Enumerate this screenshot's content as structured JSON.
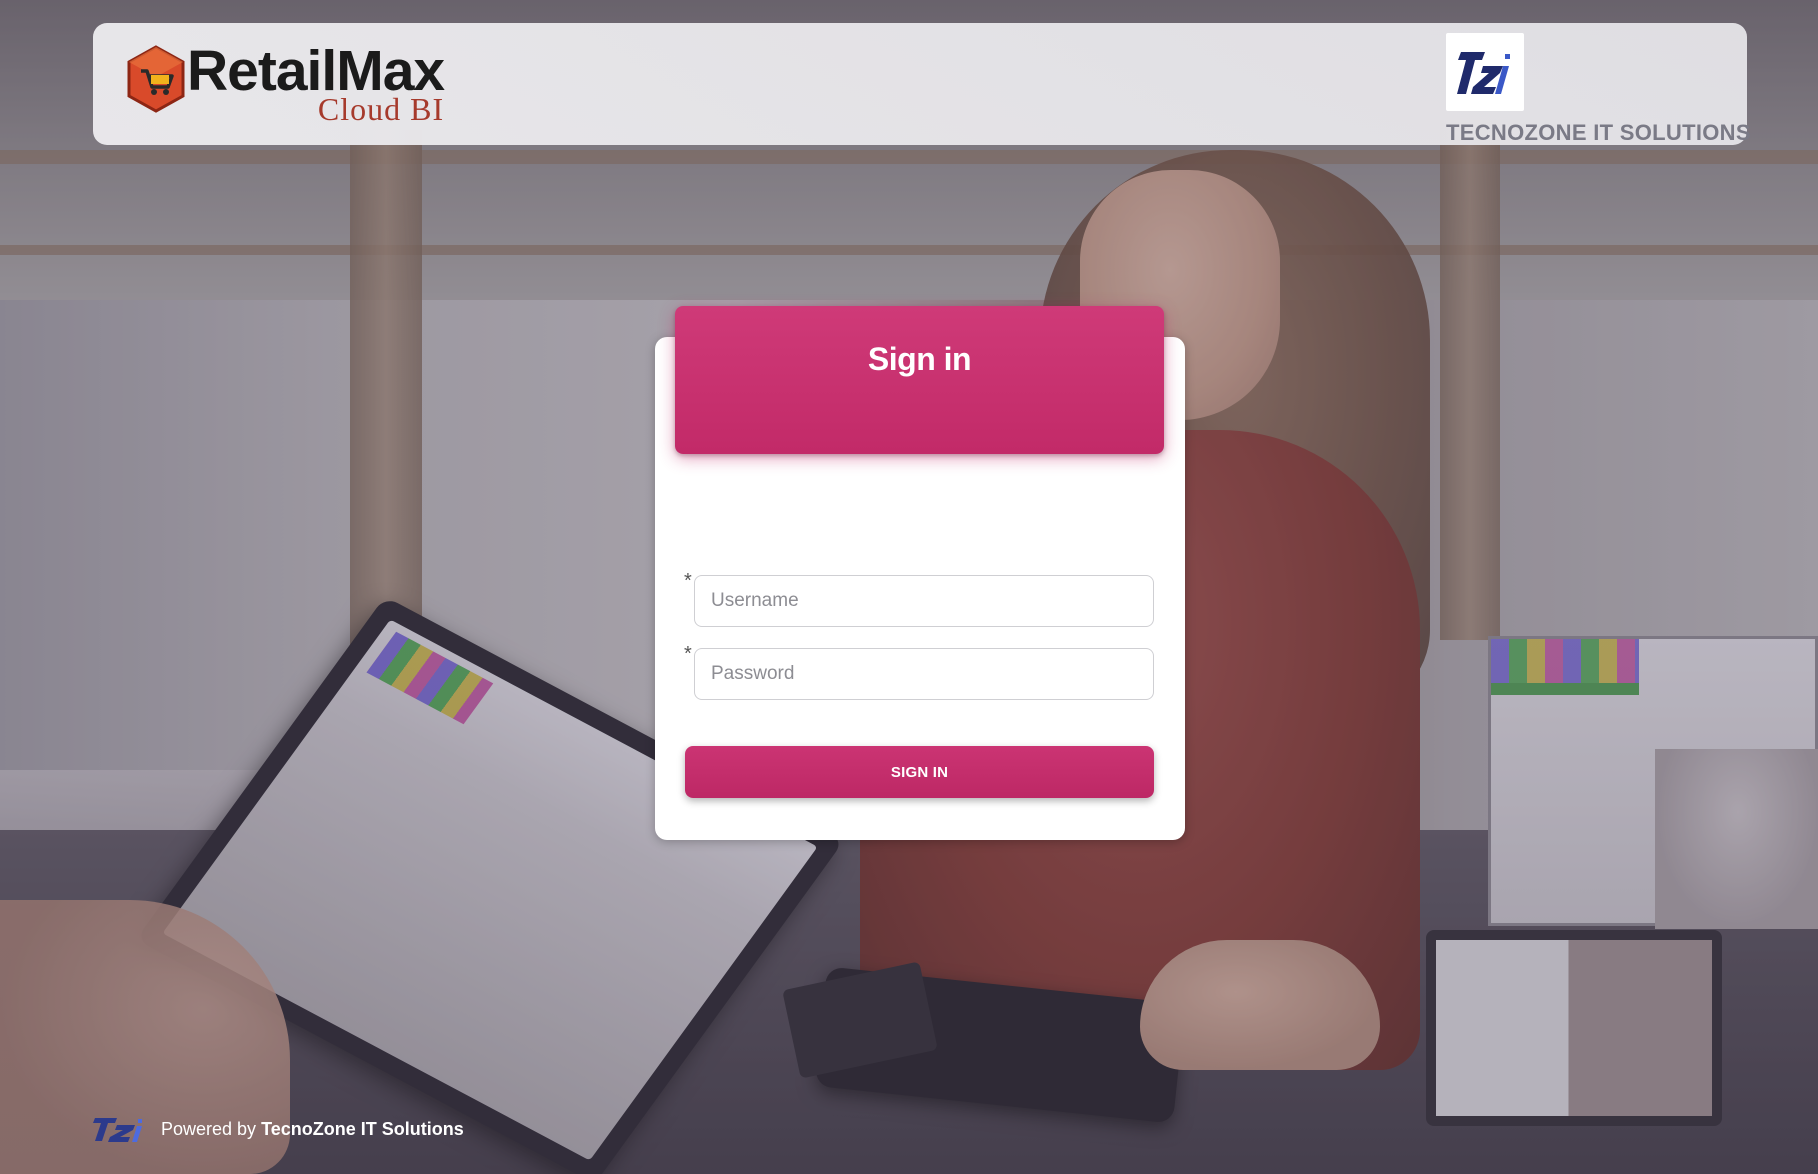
{
  "header": {
    "brand": {
      "main": "RetailMax",
      "sub": "Cloud BI",
      "logo_icon": "shopping-cart-hexagon-icon"
    },
    "partner": {
      "logo_text": "TZi",
      "name": "TECNOZONE IT SOLUTIONS",
      "logo_icon": "tz-logo-icon"
    }
  },
  "signin": {
    "title": "Sign in",
    "username": {
      "placeholder": "Username",
      "value": "",
      "required_mark": "*"
    },
    "password": {
      "placeholder": "Password",
      "value": "",
      "required_mark": "*"
    },
    "button_label": "SIGN IN"
  },
  "footer": {
    "logo_icon": "tz-logo-icon",
    "powered_prefix": "Powered by ",
    "company": "TecnoZone IT Solutions"
  },
  "colors": {
    "accent": "#c72e6c",
    "brand_dark": "#1b1b1b",
    "brand_sub": "#a63a2c",
    "partner_text": "#7a7a86"
  }
}
